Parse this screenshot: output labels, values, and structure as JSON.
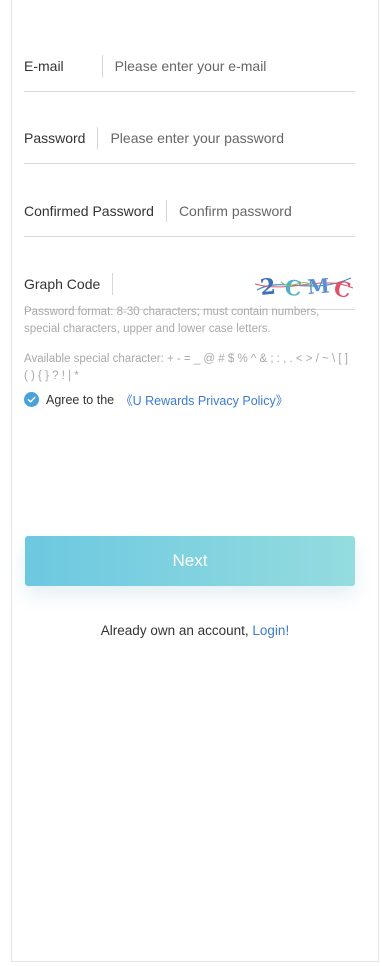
{
  "form": {
    "email": {
      "label": "E-mail",
      "placeholder": "Please enter your e-mail",
      "value": ""
    },
    "password": {
      "label": "Password",
      "placeholder": "Please enter your password",
      "value": ""
    },
    "confirm": {
      "label": "Confirmed Password",
      "placeholder": "Confirm password",
      "value": ""
    },
    "graph_code": {
      "label": "Graph Code",
      "value": "",
      "captcha_text": "2CMC"
    }
  },
  "hints": {
    "format": "Password format: 8-30 characters; must contain numbers, special characters, upper and lower case letters.",
    "special": "Available special character: + - = _ @ # $ % ^ & ; : , . < > / ~ \\ [ ] ( ) { } ? ! | *"
  },
  "agreement": {
    "prefix": "Agree to the",
    "link": "《U Rewards Privacy Policy》",
    "checked": true
  },
  "actions": {
    "next_label": "Next",
    "login_prefix": "Already own an account,",
    "login_link": "Login!"
  },
  "colors": {
    "accent": "#3a7bd5",
    "button_start": "#6cc8e0",
    "button_end": "#94dcdf",
    "check": "#4aa3d8"
  }
}
